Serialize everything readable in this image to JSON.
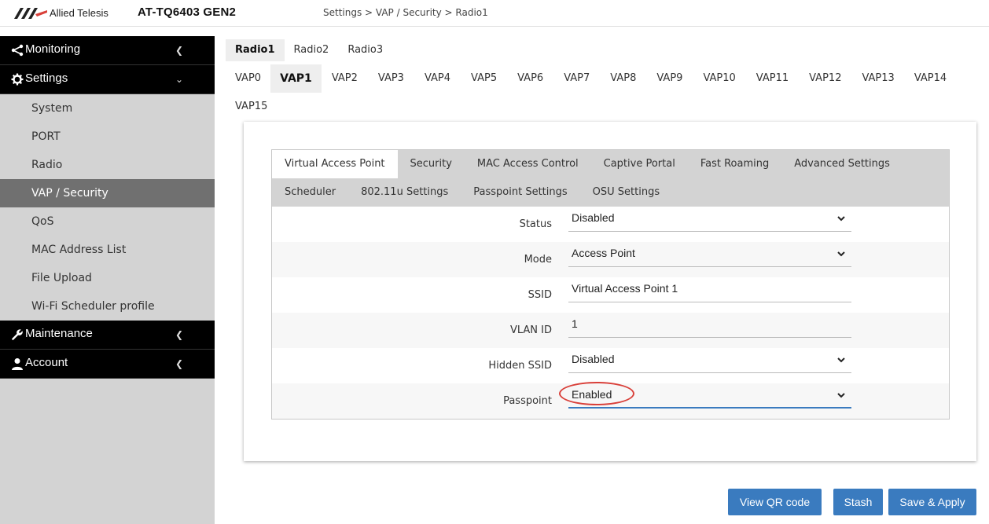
{
  "header": {
    "brand": "Allied Telesis",
    "product": "AT-TQ6403 GEN2",
    "breadcrumb": "Settings > VAP / Security > Radio1"
  },
  "sidebar": {
    "monitoring": {
      "label": "Monitoring",
      "icon": "share-icon"
    },
    "settings": {
      "label": "Settings",
      "icon": "gear-icon",
      "items": [
        {
          "label": "System"
        },
        {
          "label": "PORT"
        },
        {
          "label": "Radio"
        },
        {
          "label": "VAP / Security",
          "active": true
        },
        {
          "label": "QoS"
        },
        {
          "label": "MAC Address List"
        },
        {
          "label": "File Upload"
        },
        {
          "label": "Wi-Fi Scheduler profile"
        }
      ]
    },
    "maintenance": {
      "label": "Maintenance",
      "icon": "wrench-icon"
    },
    "account": {
      "label": "Account",
      "icon": "user-icon"
    }
  },
  "radio_tabs": [
    "Radio1",
    "Radio2",
    "Radio3"
  ],
  "radio_selected": "Radio1",
  "vap_tabs": [
    "VAP0",
    "VAP1",
    "VAP2",
    "VAP3",
    "VAP4",
    "VAP5",
    "VAP6",
    "VAP7",
    "VAP8",
    "VAP9",
    "VAP10",
    "VAP11",
    "VAP12",
    "VAP13",
    "VAP14",
    "VAP15"
  ],
  "vap_selected": "VAP1",
  "inner_tabs_row1": [
    "Virtual Access Point",
    "Security",
    "MAC Access Control",
    "Captive Portal",
    "Fast Roaming",
    "Advanced Settings"
  ],
  "inner_tabs_row2": [
    "Scheduler",
    "802.11u Settings",
    "Passpoint Settings",
    "OSU Settings"
  ],
  "inner_selected": "Virtual Access Point",
  "form": {
    "status": {
      "label": "Status",
      "value": "Disabled"
    },
    "mode": {
      "label": "Mode",
      "value": "Access Point"
    },
    "ssid": {
      "label": "SSID",
      "value": "Virtual Access Point 1"
    },
    "vlan": {
      "label": "VLAN ID",
      "value": "1"
    },
    "hidden_ssid": {
      "label": "Hidden SSID",
      "value": "Disabled"
    },
    "passpoint": {
      "label": "Passpoint",
      "value": "Enabled"
    }
  },
  "buttons": {
    "qr": "View QR code",
    "stash": "Stash",
    "save": "Save & Apply"
  },
  "colors": {
    "accent": "#3a7bbf",
    "sidebar_bg": "#d3d3d3",
    "sidebar_head": "#000000",
    "highlight": "#d9403a"
  }
}
